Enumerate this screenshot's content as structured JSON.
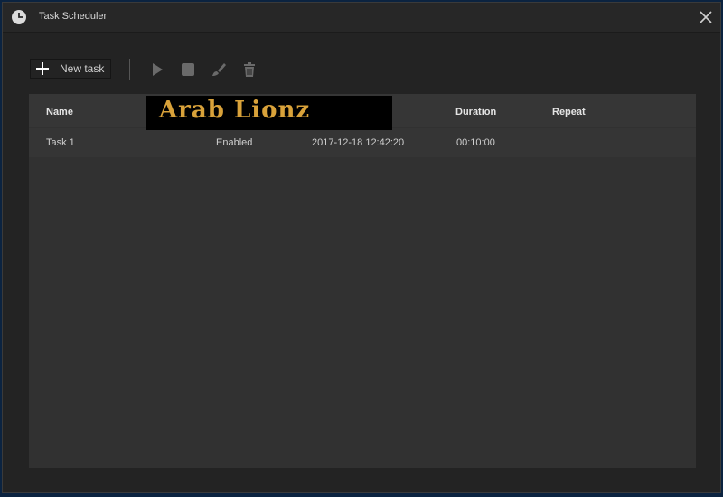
{
  "window": {
    "title": "Task Scheduler"
  },
  "toolbar": {
    "new_task_label": "New task"
  },
  "table": {
    "columns": {
      "name": "Name",
      "duration": "Duration",
      "repeat": "Repeat"
    },
    "rows": [
      {
        "name": "Task 1",
        "status": "Enabled",
        "start": "2017-12-18 12:42:20",
        "duration": "00:10:00",
        "repeat": ""
      }
    ]
  },
  "watermark": {
    "text": "Arab Lionz"
  },
  "colors": {
    "accent": "#d9a23a",
    "window_bg": "#232323",
    "panel_bg": "#313131"
  },
  "icons": [
    "clock-icon",
    "close-icon",
    "plus-icon",
    "play-icon",
    "stop-icon",
    "brush-icon",
    "trash-icon"
  ]
}
